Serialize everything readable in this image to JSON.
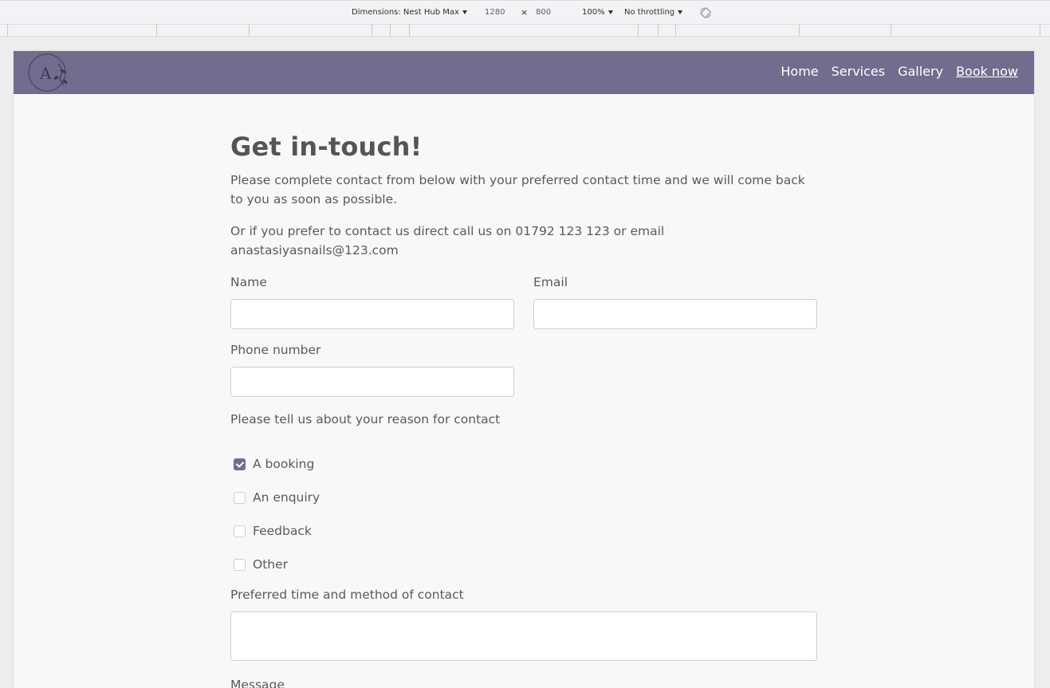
{
  "devtools": {
    "dimensions_label": "Dimensions: Nest Hub Max",
    "width_value": "1280",
    "times": "×",
    "height_value": "800",
    "zoom": "100%",
    "throttling": "No throttling"
  },
  "nav": {
    "logo_letter": "A",
    "links": [
      "Home",
      "Services",
      "Gallery",
      "Book now"
    ]
  },
  "content": {
    "title": "Get in-touch!",
    "intro": "Please complete contact from below with your preferred contact time and we will come back to you as soon as possible.",
    "direct": "Or if you prefer to contact us direct call us on 01792 123 123 or email anastasiyasnails@123.com",
    "name_label": "Name",
    "email_label": "Email",
    "phone_label": "Phone number",
    "reason_label": "Please tell us about your reason for contact",
    "reasons": [
      {
        "label": "A booking",
        "checked": true
      },
      {
        "label": "An enquiry",
        "checked": false
      },
      {
        "label": "Feedback",
        "checked": false
      },
      {
        "label": "Other",
        "checked": false
      }
    ],
    "preferred_label": "Preferred time and method of contact",
    "message_label": "Message"
  },
  "colors": {
    "accent": "#736c8e"
  }
}
